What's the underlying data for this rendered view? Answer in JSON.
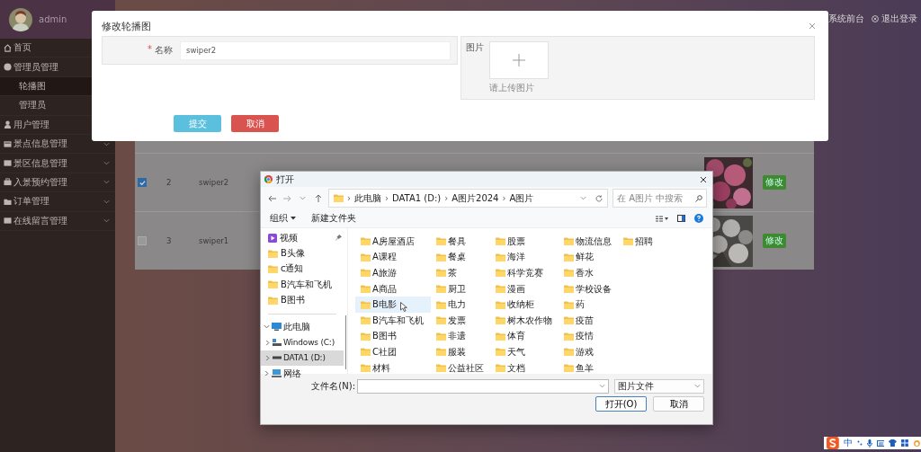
{
  "user": {
    "name": "admin"
  },
  "sidebar": {
    "items": [
      {
        "label": "首页",
        "kind": "link",
        "selected": false
      },
      {
        "label": "管理员管理",
        "kind": "group",
        "expanded": true,
        "selected": false,
        "children": [
          {
            "label": "轮播图",
            "selected": true
          },
          {
            "label": "管理员",
            "selected": false
          }
        ]
      },
      {
        "label": "用户管理",
        "kind": "link",
        "selected": false
      },
      {
        "label": "景点信息管理",
        "kind": "group",
        "expanded": false,
        "selected": false
      },
      {
        "label": "景区信息管理",
        "kind": "group",
        "expanded": false,
        "selected": false
      },
      {
        "label": "入景预约管理",
        "kind": "group",
        "expanded": false,
        "selected": false
      },
      {
        "label": "订单管理",
        "kind": "group",
        "expanded": false,
        "selected": false
      },
      {
        "label": "在线留言管理",
        "kind": "group",
        "expanded": false,
        "selected": false
      }
    ]
  },
  "header": {
    "links": [
      {
        "kind": "home",
        "label": "系统前台"
      },
      {
        "kind": "logout",
        "label": "退出登录"
      }
    ]
  },
  "table": {
    "rows": [
      {
        "checked": true,
        "id": "2",
        "name": "swiper2",
        "action": "修改"
      },
      {
        "checked": false,
        "id": "3",
        "name": "swiper1",
        "action": "修改"
      }
    ]
  },
  "modal": {
    "title": "修改轮播图",
    "fields": [
      {
        "label": "名称",
        "required_mark": "*",
        "value": "swiper2"
      }
    ],
    "upload": {
      "label": "图片",
      "hint": "请上传图片"
    },
    "buttons": [
      {
        "label": "提交",
        "kind": "primary"
      },
      {
        "label": "取消",
        "kind": "danger"
      }
    ]
  },
  "file_dialog": {
    "title": "打开",
    "path": [
      {
        "separator": "›",
        "label": "此电脑"
      },
      {
        "separator": "›",
        "label": "DATA1 (D:)"
      },
      {
        "separator": "›",
        "label": "A图片2024"
      },
      {
        "separator": "›",
        "label": "A图片"
      }
    ],
    "search": {
      "placeholder": "在 A图片 中搜索"
    },
    "toolbar": [
      {
        "label": "组织",
        "kind": "menu"
      },
      {
        "label": "新建文件夹",
        "kind": "button"
      }
    ],
    "quick_access": [
      {
        "label": "视频",
        "kind": "video",
        "pinned": true
      },
      {
        "label": "B头像",
        "kind": "folder",
        "pinned": false
      },
      {
        "label": "c通知",
        "kind": "folder",
        "pinned": false
      },
      {
        "label": "B汽车和飞机",
        "kind": "folder",
        "pinned": false
      },
      {
        "label": "B图书",
        "kind": "folder",
        "pinned": false
      }
    ],
    "tree": [
      {
        "label": "此电脑",
        "kind": "pc",
        "expanded": true,
        "selected": false,
        "children": [
          {
            "label": "Windows (C:)",
            "kind": "system-drive",
            "expanded": false,
            "selected": false
          },
          {
            "label": "DATA1 (D:)",
            "kind": "drive",
            "expanded": false,
            "selected": true
          }
        ]
      },
      {
        "label": "网络",
        "kind": "network",
        "expanded": false,
        "selected": false
      }
    ],
    "folders": [
      {
        "name": "A房屋酒店",
        "highlighted": false
      },
      {
        "name": "A课程",
        "highlighted": false
      },
      {
        "name": "A旅游",
        "highlighted": false
      },
      {
        "name": "A商品",
        "highlighted": false
      },
      {
        "name": "B电影",
        "highlighted": true
      },
      {
        "name": "B汽车和飞机",
        "highlighted": false
      },
      {
        "name": "B图书",
        "highlighted": false
      },
      {
        "name": "C社团",
        "highlighted": false
      },
      {
        "name": "材料",
        "highlighted": false
      },
      {
        "name": "餐具",
        "highlighted": false
      },
      {
        "name": "餐桌",
        "highlighted": false
      },
      {
        "name": "茶",
        "highlighted": false
      },
      {
        "name": "厨卫",
        "highlighted": false
      },
      {
        "name": "电力",
        "highlighted": false
      },
      {
        "name": "发票",
        "highlighted": false
      },
      {
        "name": "非遗",
        "highlighted": false
      },
      {
        "name": "服装",
        "highlighted": false
      },
      {
        "name": "公益社区",
        "highlighted": false
      },
      {
        "name": "股票",
        "highlighted": false
      },
      {
        "name": "海洋",
        "highlighted": false
      },
      {
        "name": "科学竞赛",
        "highlighted": false
      },
      {
        "name": "漫画",
        "highlighted": false
      },
      {
        "name": "收纳柜",
        "highlighted": false
      },
      {
        "name": "树木农作物",
        "highlighted": false
      },
      {
        "name": "体育",
        "highlighted": false
      },
      {
        "name": "天气",
        "highlighted": false
      },
      {
        "name": "文档",
        "highlighted": false
      },
      {
        "name": "物流信息",
        "highlighted": false
      },
      {
        "name": "鲜花",
        "highlighted": false
      },
      {
        "name": "香水",
        "highlighted": false
      },
      {
        "name": "学校设备",
        "highlighted": false
      },
      {
        "name": "药",
        "highlighted": false
      },
      {
        "name": "疫苗",
        "highlighted": false
      },
      {
        "name": "疫情",
        "highlighted": false
      },
      {
        "name": "游戏",
        "highlighted": false
      },
      {
        "name": "鱼羊",
        "highlighted": false
      },
      {
        "name": "招聘",
        "highlighted": false
      }
    ],
    "filename": {
      "label": "文件名(N):"
    },
    "file_type": "图片文件",
    "buttons": [
      {
        "label": "打开(O)",
        "kind": "default"
      },
      {
        "label": "取消",
        "kind": "normal"
      }
    ]
  },
  "tray": {
    "ime": "中"
  }
}
